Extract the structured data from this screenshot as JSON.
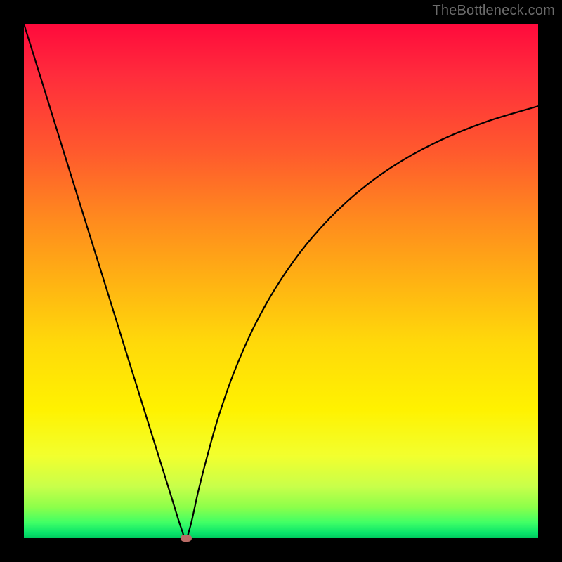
{
  "attribution": "TheBottleneck.com",
  "chart_data": {
    "type": "line",
    "title": "",
    "xlabel": "",
    "ylabel": "",
    "xlim": [
      0,
      100
    ],
    "ylim": [
      0,
      100
    ],
    "grid": false,
    "series": [
      {
        "name": "bottleneck-curve",
        "x": [
          0,
          4,
          8,
          12,
          16,
          20,
          24,
          27,
          29,
          30.5,
          31.5,
          32.5,
          34,
          36,
          38,
          41,
          45,
          50,
          56,
          63,
          71,
          80,
          90,
          100
        ],
        "values": [
          100,
          87.2,
          74.3,
          61.5,
          48.7,
          35.8,
          23.0,
          13.4,
          7.0,
          2.2,
          0.0,
          2.8,
          9.5,
          17.2,
          24.1,
          32.6,
          41.6,
          50.3,
          58.4,
          65.6,
          71.8,
          76.9,
          81.0,
          84.0
        ]
      }
    ],
    "marker": {
      "x": 31.5,
      "y": 0.0,
      "color": "#ba6b66"
    },
    "background_gradient": {
      "type": "vertical",
      "stops": [
        {
          "pos": 0.0,
          "color": "#ff0a3c"
        },
        {
          "pos": 0.5,
          "color": "#ffb213"
        },
        {
          "pos": 0.75,
          "color": "#fff200"
        },
        {
          "pos": 1.0,
          "color": "#00c95e"
        }
      ]
    }
  }
}
